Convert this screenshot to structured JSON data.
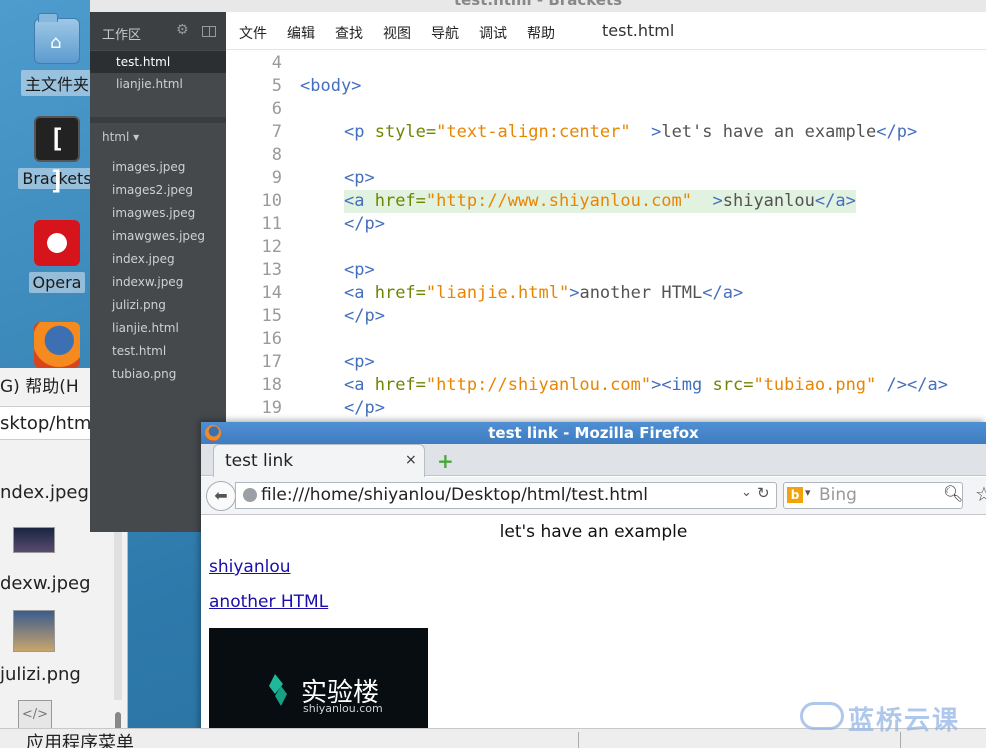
{
  "desktop": {
    "icons": [
      {
        "label": "主文件夹",
        "icon": "home-folder-icon"
      },
      {
        "label": "Brackets",
        "icon": "brackets-icon"
      },
      {
        "label": "Opera",
        "icon": "opera-icon"
      },
      {
        "label": "",
        "icon": "firefox-icon"
      }
    ]
  },
  "filemgr": {
    "menu_text": "G)  帮助(H",
    "path": "sktop/html",
    "files": [
      "ndex.jpeg",
      "dexw.jpeg",
      "julizi.png"
    ]
  },
  "brackets": {
    "window_title": "test.html - Brackets",
    "sidebar": {
      "working_files_header": "工作区",
      "working_files": [
        "test.html",
        "lianjie.html"
      ],
      "project_header": "html ▾",
      "project_files": [
        "images.jpeg",
        "images2.jpeg",
        "imagwes.jpeg",
        "imawgwes.jpeg",
        "index.jpeg",
        "indexw.jpeg",
        "julizi.png",
        "lianjie.html",
        "test.html",
        "tubiao.png"
      ]
    },
    "menu": [
      "文件",
      "编辑",
      "查找",
      "视图",
      "导航",
      "调试",
      "帮助"
    ],
    "current_file": "test.html",
    "code": [
      {
        "n": "4"
      },
      {
        "n": "5"
      },
      {
        "n": "6"
      },
      {
        "n": "7"
      },
      {
        "n": "8"
      },
      {
        "n": "9"
      },
      {
        "n": "10"
      },
      {
        "n": "11"
      },
      {
        "n": "12"
      },
      {
        "n": "13"
      },
      {
        "n": "14"
      },
      {
        "n": "15"
      },
      {
        "n": "16"
      },
      {
        "n": "17"
      },
      {
        "n": "18"
      },
      {
        "n": "19"
      }
    ],
    "code_text": {
      "l5_tag": "<body>",
      "l7_open": "<p",
      "l7_attr": " style=",
      "l7_str": "\"text-align:center\"",
      "l7_close": "  >",
      "l7_text": "let's have an example",
      "l7_end": "</p>",
      "l9": "<p>",
      "l10_open": "<a",
      "l10_attr": " href=",
      "l10_str": "\"http://www.shiyanlou.com\"",
      "l10_close": "  >",
      "l10_text": "shiyanlou",
      "l10_end": "</a>",
      "l11": "</p>",
      "l13": "<p>",
      "l14_open": "<a",
      "l14_attr": " href=",
      "l14_str": "\"lianjie.html\"",
      "l14_close": ">",
      "l14_text": "another HTML",
      "l14_end": "</a>",
      "l15": "</p>",
      "l17": "<p>",
      "l18_open": "<a",
      "l18_attr": " href=",
      "l18_str": "\"http://shiyanlou.com\"",
      "l18_close": "><img",
      "l18_attr2": " src=",
      "l18_str2": "\"tubiao.png\"",
      "l18_end": " /></a>",
      "l19": "</p>"
    }
  },
  "firefox": {
    "window_title": "test link - Mozilla Firefox",
    "tab_title": "test link",
    "tab_close": "×",
    "new_tab": "+",
    "url": "file:///home/shiyanlou/Desktop/html/test.html",
    "search_placeholder": "Bing",
    "page": {
      "heading_text": "let's have an example",
      "link1": "shiyanlou",
      "link2": "another HTML",
      "image_text": "实验楼",
      "image_subtext": "shiyanlou.com"
    }
  },
  "taskbar": {
    "apps_menu": "应用程序菜单"
  },
  "watermark": "蓝桥云课"
}
